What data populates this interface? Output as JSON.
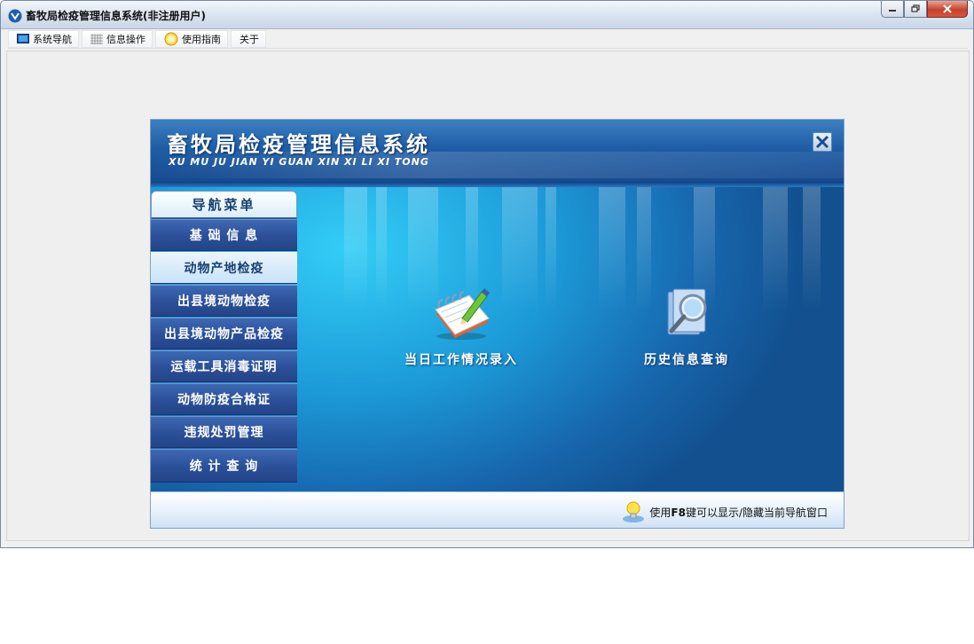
{
  "window": {
    "title": "畜牧局检疫管理信息系统(非注册用户)"
  },
  "menubar": {
    "items": [
      {
        "label": "系统导航",
        "icon": "monitor-icon"
      },
      {
        "label": "信息操作",
        "icon": "grid-icon"
      },
      {
        "label": "使用指南",
        "icon": "smiley-icon"
      },
      {
        "label": "关于",
        "icon": ""
      }
    ]
  },
  "dialog": {
    "title": "畜牧局检疫管理信息系统",
    "subtitle": "XU MU JU JIAN YI GUAN  XIN XI LI XI TONG",
    "nav": {
      "header": "导航菜单",
      "items": [
        {
          "label": "基 础 信 息",
          "active": false
        },
        {
          "label": "动物产地检疫",
          "active": true
        },
        {
          "label": "出县境动物检疫",
          "active": false
        },
        {
          "label": "出县境动物产品检疫",
          "active": false
        },
        {
          "label": "运载工具消毒证明",
          "active": false
        },
        {
          "label": "动物防疫合格证",
          "active": false
        },
        {
          "label": "违规处罚管理",
          "active": false
        },
        {
          "label": "统 计 查 询",
          "active": false
        }
      ]
    },
    "actions": [
      {
        "label": "当日工作情况录入",
        "icon": "notebook-pencil-icon"
      },
      {
        "label": "历史信息查询",
        "icon": "magnifier-document-icon"
      }
    ],
    "footer": {
      "tip_prefix": "使用",
      "tip_key": "F8",
      "tip_suffix": "键可以显示/隐藏当前导航窗口"
    }
  },
  "colors": {
    "nav_item": "#2b4f98",
    "nav_active": "#c9e3f7",
    "body_light": "#33cdf6",
    "body_dark": "#12508f"
  }
}
